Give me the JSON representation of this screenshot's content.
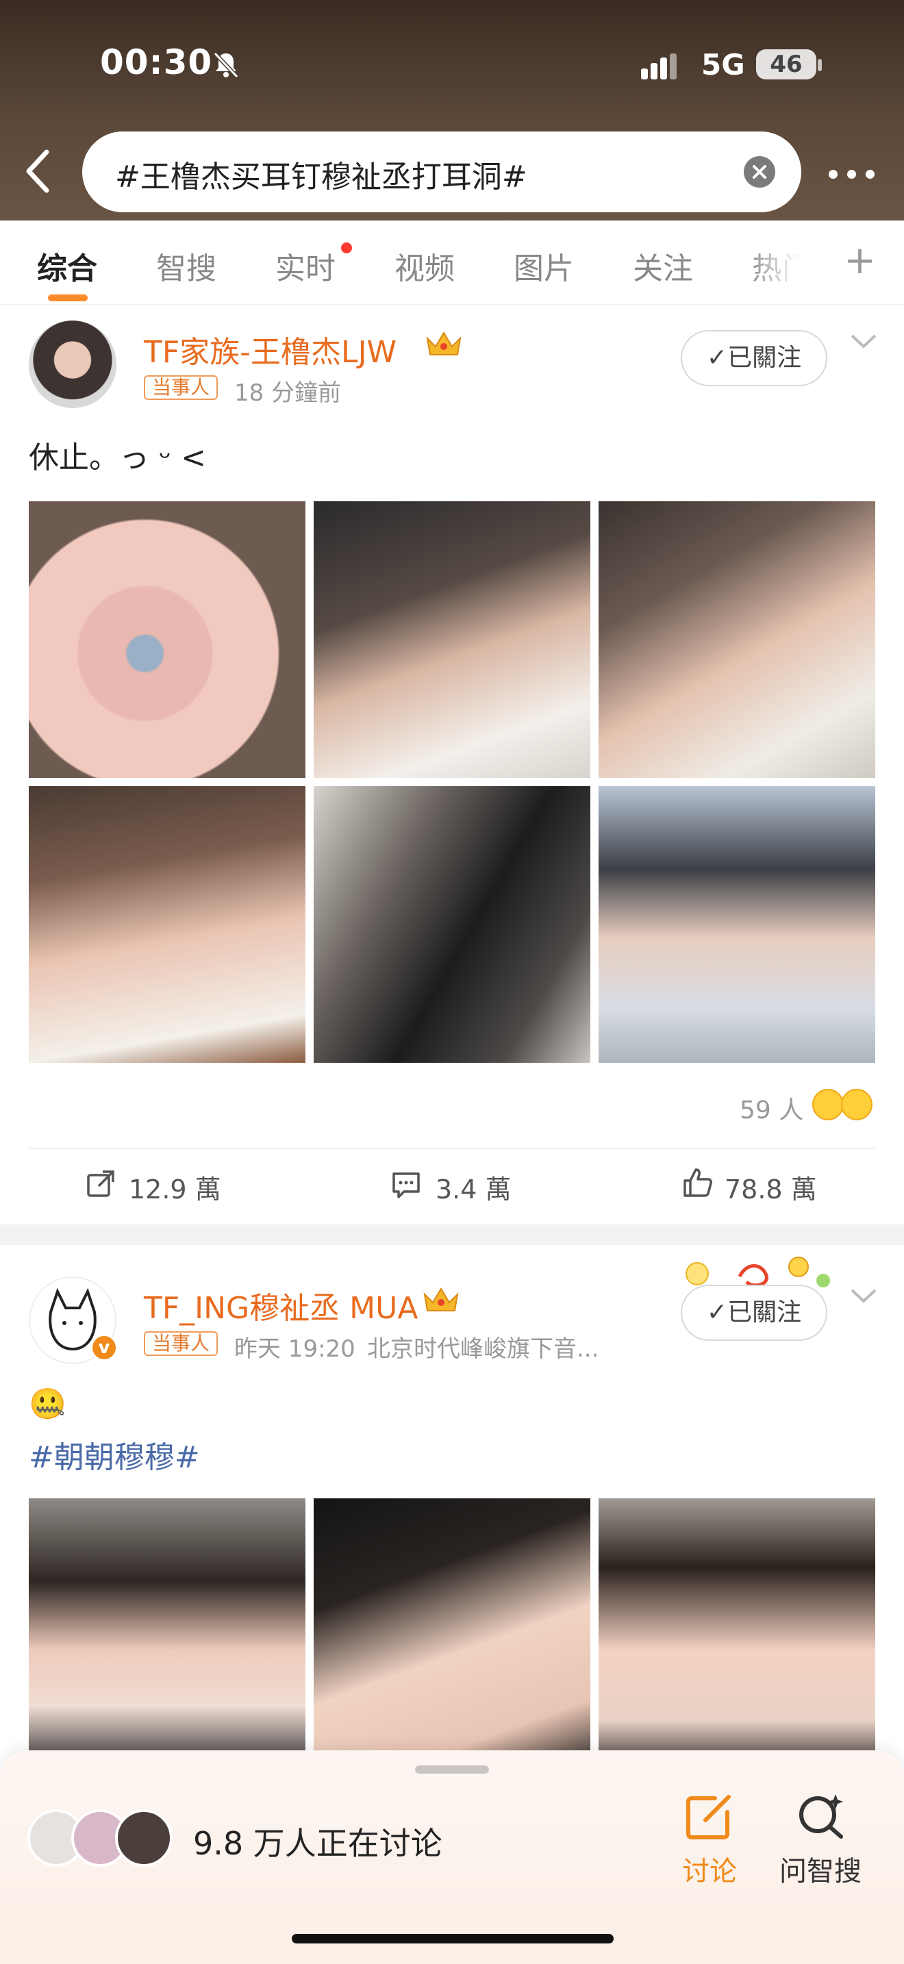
{
  "status_bar": {
    "time": "00:30",
    "network": "5G",
    "battery": "46"
  },
  "search": {
    "query": "#王橹杰买耳钉穆祉丞打耳洞#"
  },
  "tabs": [
    {
      "label": "综合"
    },
    {
      "label": "智搜"
    },
    {
      "label": "实时"
    },
    {
      "label": "视频"
    },
    {
      "label": "图片"
    },
    {
      "label": "关注"
    },
    {
      "label": "热门"
    }
  ],
  "posts": [
    {
      "author": "TF家族-王橹杰LJW",
      "tag": "当事人",
      "time": "18 分鐘前",
      "source": "",
      "follow_label": "已關注",
      "text": "休止。っ ᵕ <",
      "liked_by": "59 人",
      "reposts": "12.9 萬",
      "comments": "3.4 萬",
      "likes": "78.8 萬"
    },
    {
      "author": "TF_ING穆祉丞 MUA",
      "tag": "当事人",
      "time": "昨天 19:20",
      "source": "北京时代峰峻旗下音...",
      "follow_label": "已關注",
      "text": "🤐",
      "hashtag": "#朝朝穆穆#"
    }
  ],
  "bottom_sheet": {
    "discussing": "9.8 万人正在讨论",
    "discuss_label": "讨论",
    "smart_search_label": "问智搜"
  },
  "colors": {
    "accent": "#ff8a2a",
    "name": "#e86b1f",
    "hashtag": "#4a6aa8"
  }
}
